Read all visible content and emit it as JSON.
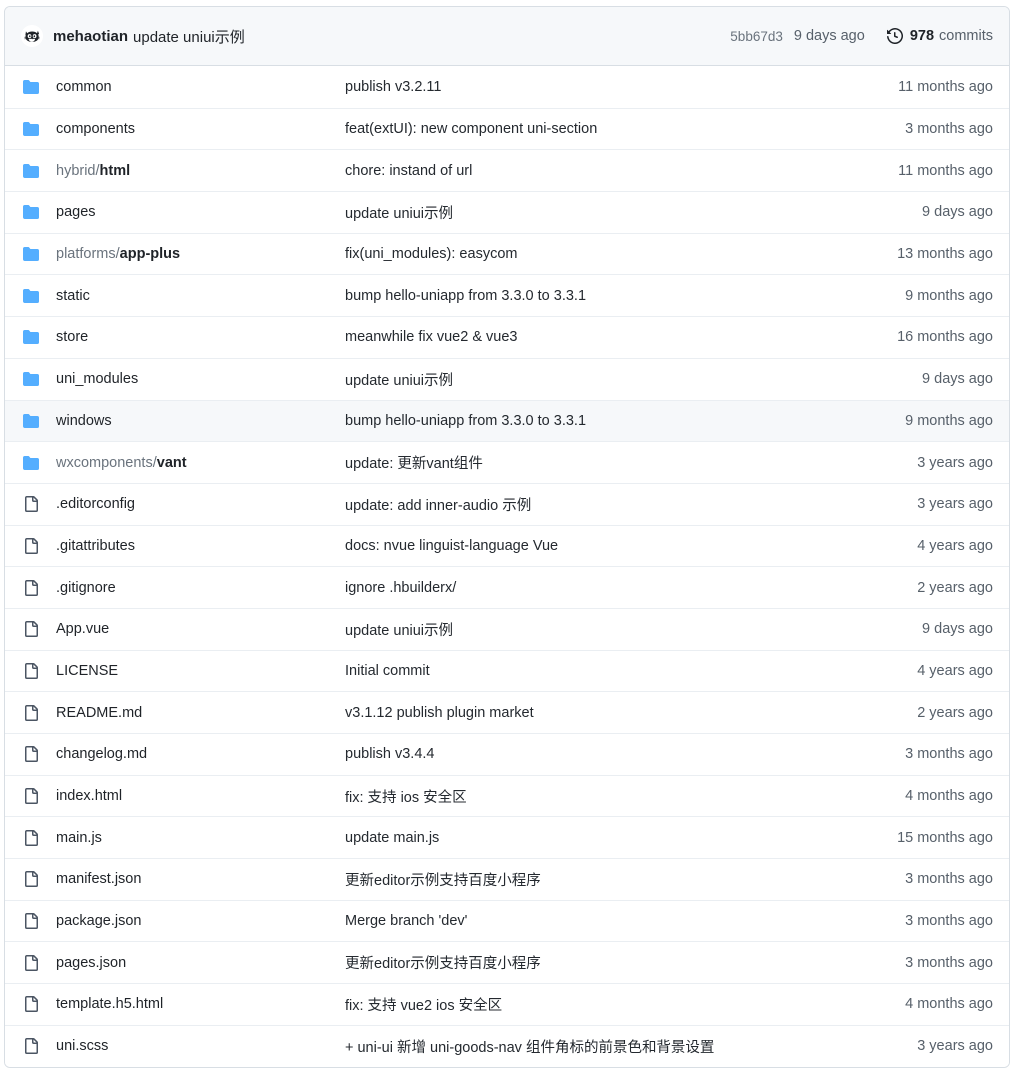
{
  "header": {
    "avatar_icon": "cat-avatar",
    "author": "mehaotian",
    "commit_message": "update uniui示例",
    "commit_sha": "5bb67d3",
    "commit_date": "9 days ago",
    "history_icon": "history-icon",
    "commits_count": "978",
    "commits_label": "commits"
  },
  "colors": {
    "folder_icon": "#54aeff",
    "file_icon": "#4b5563",
    "border": "#d8dee4",
    "row_border": "#eaeef2",
    "header_bg": "#f6f8fa",
    "hover_bg": "#f6f8fa",
    "text_primary": "#1f2328",
    "text_muted": "#57606a"
  },
  "rows": [
    {
      "icon": "folder-icon",
      "type": "folder",
      "name": "common",
      "path_prefix": "",
      "path_leaf": "common",
      "message": "publish v3.2.11",
      "age": "11 months ago",
      "hovered": false
    },
    {
      "icon": "folder-icon",
      "type": "folder",
      "name": "components",
      "path_prefix": "",
      "path_leaf": "components",
      "message": "feat(extUI): new component uni-section",
      "age": "3 months ago",
      "hovered": false
    },
    {
      "icon": "folder-icon",
      "type": "folder",
      "name": "hybrid/html",
      "path_prefix": "hybrid/",
      "path_leaf": "html",
      "message": "chore: instand of url",
      "age": "11 months ago",
      "hovered": false
    },
    {
      "icon": "folder-icon",
      "type": "folder",
      "name": "pages",
      "path_prefix": "",
      "path_leaf": "pages",
      "message": "update uniui示例",
      "age": "9 days ago",
      "hovered": false
    },
    {
      "icon": "folder-icon",
      "type": "folder",
      "name": "platforms/app-plus",
      "path_prefix": "platforms/",
      "path_leaf": "app-plus",
      "message": "fix(uni_modules): easycom",
      "age": "13 months ago",
      "hovered": false
    },
    {
      "icon": "folder-icon",
      "type": "folder",
      "name": "static",
      "path_prefix": "",
      "path_leaf": "static",
      "message": "bump hello-uniapp from 3.3.0 to 3.3.1",
      "age": "9 months ago",
      "hovered": false
    },
    {
      "icon": "folder-icon",
      "type": "folder",
      "name": "store",
      "path_prefix": "",
      "path_leaf": "store",
      "message": "meanwhile fix vue2 & vue3",
      "age": "16 months ago",
      "hovered": false
    },
    {
      "icon": "folder-icon",
      "type": "folder",
      "name": "uni_modules",
      "path_prefix": "",
      "path_leaf": "uni_modules",
      "message": "update uniui示例",
      "age": "9 days ago",
      "hovered": false
    },
    {
      "icon": "folder-icon",
      "type": "folder",
      "name": "windows",
      "path_prefix": "",
      "path_leaf": "windows",
      "message": "bump hello-uniapp from 3.3.0 to 3.3.1",
      "age": "9 months ago",
      "hovered": true
    },
    {
      "icon": "folder-icon",
      "type": "folder",
      "name": "wxcomponents/vant",
      "path_prefix": "wxcomponents/",
      "path_leaf": "vant",
      "message": "update: 更新vant组件",
      "age": "3 years ago",
      "hovered": false
    },
    {
      "icon": "file-icon",
      "type": "file",
      "name": ".editorconfig",
      "path_prefix": "",
      "path_leaf": ".editorconfig",
      "message": "update: add inner-audio 示例",
      "age": "3 years ago",
      "hovered": false
    },
    {
      "icon": "file-icon",
      "type": "file",
      "name": ".gitattributes",
      "path_prefix": "",
      "path_leaf": ".gitattributes",
      "message": "docs: nvue linguist-language Vue",
      "age": "4 years ago",
      "hovered": false
    },
    {
      "icon": "file-icon",
      "type": "file",
      "name": ".gitignore",
      "path_prefix": "",
      "path_leaf": ".gitignore",
      "message": "ignore .hbuilderx/",
      "age": "2 years ago",
      "hovered": false
    },
    {
      "icon": "file-icon",
      "type": "file",
      "name": "App.vue",
      "path_prefix": "",
      "path_leaf": "App.vue",
      "message": "update uniui示例",
      "age": "9 days ago",
      "hovered": false
    },
    {
      "icon": "file-icon",
      "type": "file",
      "name": "LICENSE",
      "path_prefix": "",
      "path_leaf": "LICENSE",
      "message": "Initial commit",
      "age": "4 years ago",
      "hovered": false
    },
    {
      "icon": "file-icon",
      "type": "file",
      "name": "README.md",
      "path_prefix": "",
      "path_leaf": "README.md",
      "message": "v3.1.12 publish plugin market",
      "age": "2 years ago",
      "hovered": false
    },
    {
      "icon": "file-icon",
      "type": "file",
      "name": "changelog.md",
      "path_prefix": "",
      "path_leaf": "changelog.md",
      "message": "publish v3.4.4",
      "age": "3 months ago",
      "hovered": false
    },
    {
      "icon": "file-icon",
      "type": "file",
      "name": "index.html",
      "path_prefix": "",
      "path_leaf": "index.html",
      "message": "fix: 支持 ios 安全区",
      "age": "4 months ago",
      "hovered": false
    },
    {
      "icon": "file-icon",
      "type": "file",
      "name": "main.js",
      "path_prefix": "",
      "path_leaf": "main.js",
      "message": "update main.js",
      "age": "15 months ago",
      "hovered": false
    },
    {
      "icon": "file-icon",
      "type": "file",
      "name": "manifest.json",
      "path_prefix": "",
      "path_leaf": "manifest.json",
      "message": "更新editor示例支持百度小程序",
      "age": "3 months ago",
      "hovered": false
    },
    {
      "icon": "file-icon",
      "type": "file",
      "name": "package.json",
      "path_prefix": "",
      "path_leaf": "package.json",
      "message": "Merge branch 'dev'",
      "age": "3 months ago",
      "hovered": false
    },
    {
      "icon": "file-icon",
      "type": "file",
      "name": "pages.json",
      "path_prefix": "",
      "path_leaf": "pages.json",
      "message": "更新editor示例支持百度小程序",
      "age": "3 months ago",
      "hovered": false
    },
    {
      "icon": "file-icon",
      "type": "file",
      "name": "template.h5.html",
      "path_prefix": "",
      "path_leaf": "template.h5.html",
      "message": "fix: 支持 vue2 ios 安全区",
      "age": "4 months ago",
      "hovered": false
    },
    {
      "icon": "file-icon",
      "type": "file",
      "name": "uni.scss",
      "path_prefix": "",
      "path_leaf": "uni.scss",
      "message": "+ uni-ui 新增 uni-goods-nav 组件角标的前景色和背景设置",
      "age": "3 years ago",
      "hovered": false
    }
  ]
}
